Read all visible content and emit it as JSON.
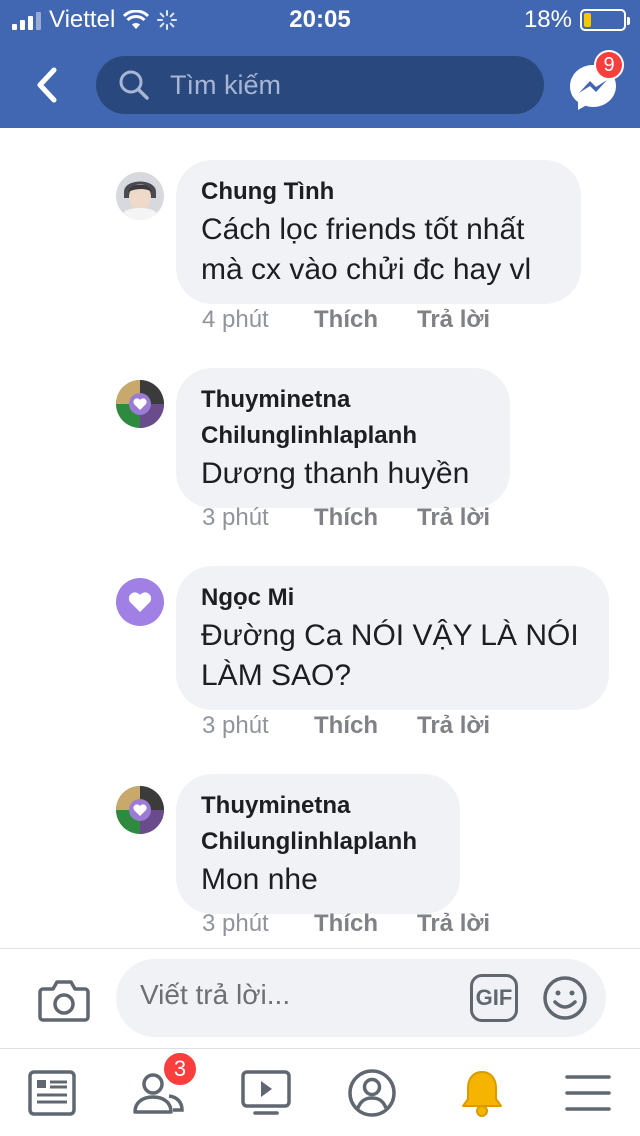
{
  "status_bar": {
    "carrier": "Viettel",
    "time": "20:05",
    "battery_percent": "18%",
    "battery_level": 0.18,
    "signal_bars": 3
  },
  "nav": {
    "search_placeholder": "Tìm kiếm",
    "messenger_badge": "9"
  },
  "comments": [
    {
      "author": "Chung Tình",
      "text": "Cách lọc friends tốt nhất mà cx vào chửi đc hay vl",
      "time": "4 phút",
      "like_label": "Thích",
      "reply_label": "Trả lời",
      "avatar": "photo-avatar"
    },
    {
      "author": "Thuyminetna Chilunglinhlaplanh",
      "text": "Dương thanh huyền",
      "time": "3 phút",
      "like_label": "Thích",
      "reply_label": "Trả lời",
      "avatar": "collage-avatar"
    },
    {
      "author": "Ngọc Mi",
      "text": "Đường Ca NÓI VẬY LÀ NÓI LÀM SAO?",
      "time": "3 phút",
      "like_label": "Thích",
      "reply_label": "Trả lời",
      "avatar": "purple-heart-avatar"
    },
    {
      "author": "Thuyminetna Chilunglinhlaplanh",
      "text": "Mon nhe",
      "time": "3 phút",
      "like_label": "Thích",
      "reply_label": "Trả lời",
      "avatar": "collage-avatar"
    }
  ],
  "composer": {
    "placeholder": "Viết trả lời...",
    "gif_label": "GIF"
  },
  "tab_bar": {
    "friends_badge": "3",
    "tabs": [
      "news-feed-icon",
      "friends-icon",
      "watch-icon",
      "profile-icon",
      "notifications-icon",
      "menu-icon"
    ]
  },
  "colors": {
    "brand_blue": "#4267b2",
    "search_bg": "#29487d",
    "bubble_bg": "#f1f2f5",
    "badge_red": "#fa3e3e",
    "bell_yellow": "#f5b400"
  }
}
